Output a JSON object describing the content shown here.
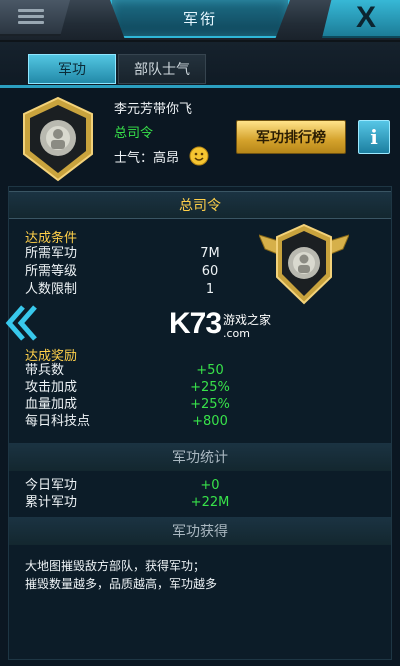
{
  "topbar": {
    "title": "军衔"
  },
  "tabs": [
    {
      "label": "军功"
    },
    {
      "label": "部队士气"
    }
  ],
  "player": {
    "name": "李元芳带你飞",
    "rank": "总司令",
    "morale_label": "士气：高昂"
  },
  "buttons": {
    "ranking": "军功排行榜",
    "info": "i"
  },
  "rank_section": {
    "title": "总司令",
    "conditions_title": "达成条件",
    "conditions": [
      {
        "label": "所需军功",
        "value": "7M"
      },
      {
        "label": "所需等级",
        "value": "60"
      },
      {
        "label": "人数限制",
        "value": "1"
      }
    ],
    "rewards_title": "达成奖励",
    "rewards": [
      {
        "label": "带兵数",
        "value": "+50"
      },
      {
        "label": "攻击加成",
        "value": "+25%"
      },
      {
        "label": "血量加成",
        "value": "+25%"
      },
      {
        "label": "每日科技点",
        "value": "+800"
      }
    ]
  },
  "stats_section": {
    "title": "军功统计",
    "rows": [
      {
        "label": "今日军功",
        "value": "+0"
      },
      {
        "label": "累计军功",
        "value": "+22M"
      }
    ]
  },
  "obtain_section": {
    "title": "军功获得",
    "lines": [
      "大地图摧毁敌方部队，获得军功；",
      "摧毁数量越多，品质越高，军功越多"
    ]
  },
  "watermark": {
    "brand": "K73",
    "site_cn": "游戏之家",
    "site_en": ".com"
  },
  "colors": {
    "accent": "#2fb7d8",
    "gold": "#ffd04a",
    "green": "#38e24a",
    "background": "#0b1722"
  },
  "icons": [
    "menu-icon",
    "close-icon",
    "rank-badge-icon",
    "smile-icon",
    "info-icon",
    "back-arrow-icon"
  ]
}
